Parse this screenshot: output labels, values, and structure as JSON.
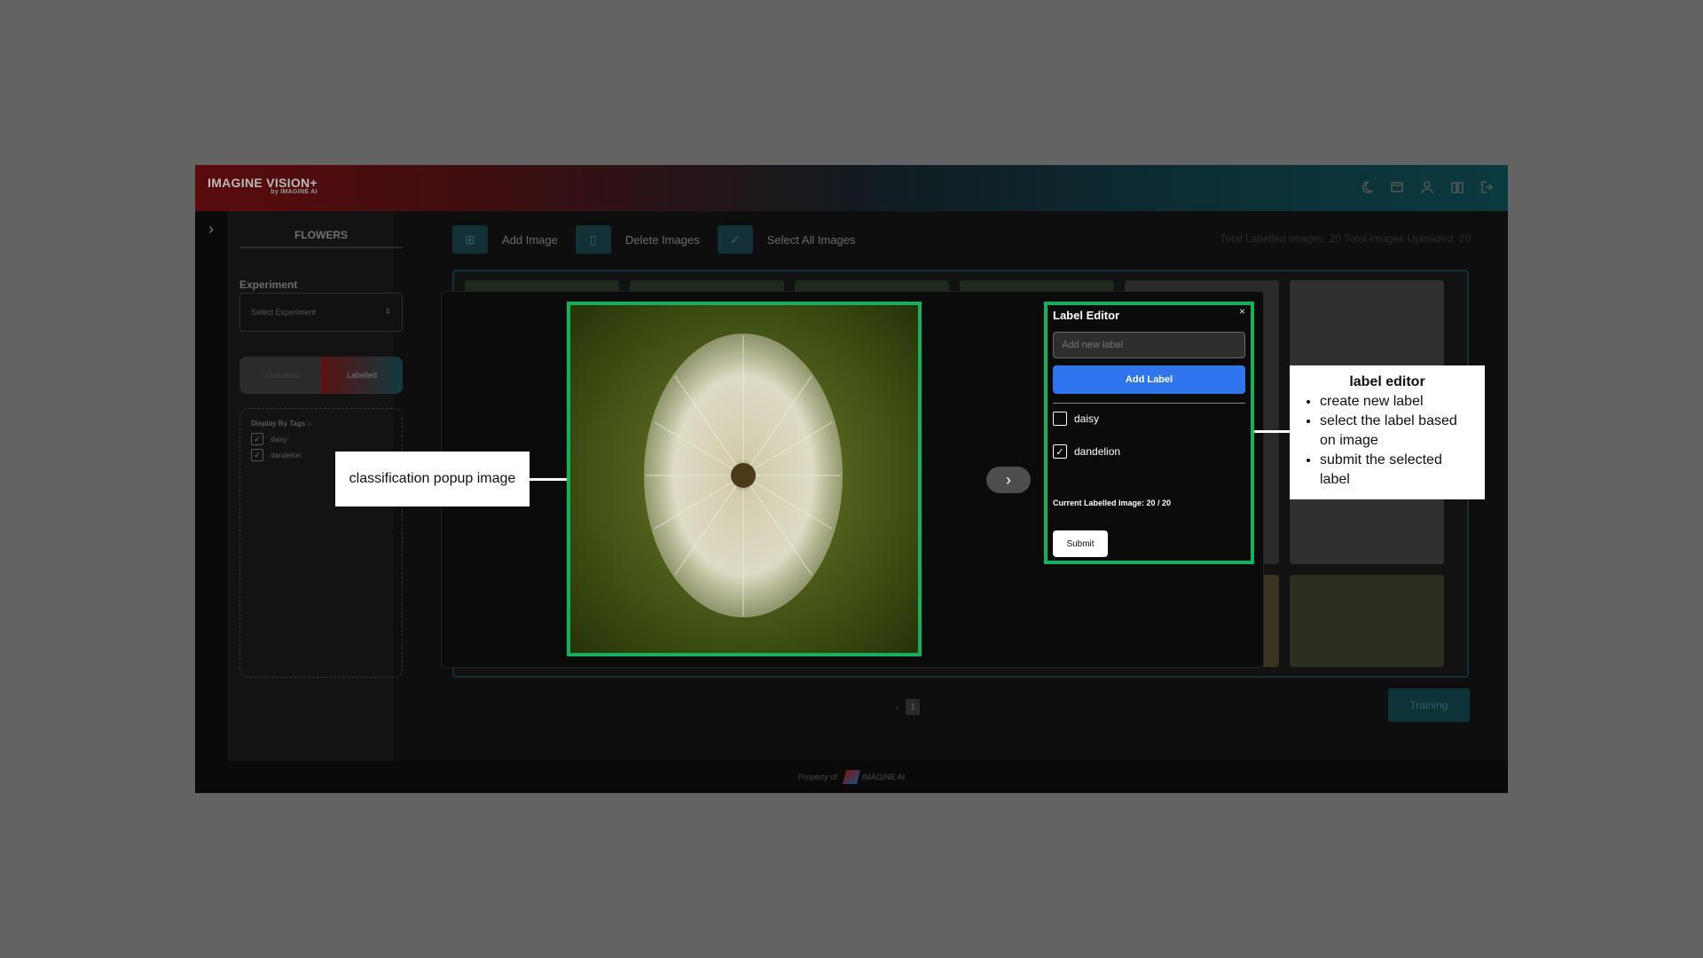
{
  "header": {
    "brand": "IMAGINE VISION+",
    "brand_sub": "by IMAGINE AI",
    "icons": [
      "moon-icon",
      "window-icon",
      "user-icon",
      "book-icon",
      "logout-icon"
    ]
  },
  "sidebar": {
    "project_name": "FLOWERS",
    "experiment_label": "Experiment",
    "experiment_placeholder": "Select Experiment",
    "toggle": [
      "Unlabelled",
      "Labelled"
    ],
    "tags_title": "Display By Tags :-",
    "tags": [
      {
        "label": "daisy",
        "checked": true
      },
      {
        "label": "dandelion",
        "checked": true
      }
    ]
  },
  "toolbar": {
    "add_image": "Add Image",
    "delete_images": "Delete Images",
    "select_all": "Select All Images",
    "stats": "Total Labelled Images: 20   Total Images Uploaded: 20"
  },
  "pager": {
    "page": "1"
  },
  "training_button": "Training",
  "footer": {
    "text": "Property of",
    "logo": "IMAGINE AI"
  },
  "editor": {
    "title": "Label Editor",
    "close": "×",
    "input_placeholder": "Add new label",
    "add_label": "Add Label",
    "options": [
      {
        "label": "daisy",
        "checked": false
      },
      {
        "label": "dandelion",
        "checked": true
      }
    ],
    "count": "Current Labelled Image: 20 / 20",
    "submit": "Submit"
  },
  "callouts": {
    "image": "classification popup image",
    "editor_title": "label editor",
    "editor_items": [
      "create new label",
      "select the label based on image",
      "submit the selected label"
    ]
  },
  "colors": {
    "highlight": "#10b45c",
    "primary": "#2f74ef",
    "overlay": "#636363"
  }
}
